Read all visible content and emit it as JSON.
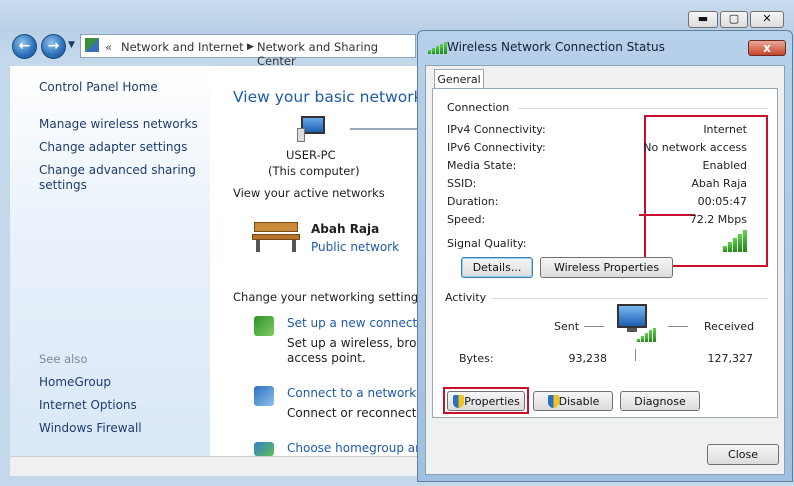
{
  "explorer": {
    "breadcrumb": [
      "Network and Internet",
      "Network and Sharing Center"
    ],
    "left_links": [
      "Control Panel Home",
      "Manage wireless networks",
      "Change adapter settings",
      "Change advanced sharing settings"
    ],
    "see_also_heading": "See also",
    "see_also": [
      "HomeGroup",
      "Internet Options",
      "Windows Firewall"
    ],
    "main_title": "View your basic network in",
    "computer_name": "USER-PC",
    "computer_sub": "(This computer)",
    "active_networks_heading": "View your active networks",
    "network_name": "Abah Raja",
    "network_type": "Public network",
    "change_settings_heading": "Change your networking settings",
    "tasks": [
      {
        "title": "Set up a new connection",
        "desc1": "Set up a wireless, broadb",
        "desc2": "access point."
      },
      {
        "title": "Connect to a network",
        "desc1": "Connect or reconnect to",
        "desc2": ""
      },
      {
        "title": "Choose homegroup and",
        "desc1": "",
        "desc2": ""
      }
    ]
  },
  "dialog": {
    "title": "Wireless Network Connection Status",
    "close_glyph": "x",
    "tab": "General",
    "connection_heading": "Connection",
    "rows": [
      {
        "label": "IPv4 Connectivity:",
        "value": "Internet"
      },
      {
        "label": "IPv6 Connectivity:",
        "value": "No network access"
      },
      {
        "label": "Media State:",
        "value": "Enabled"
      },
      {
        "label": "SSID:",
        "value": "Abah Raja"
      },
      {
        "label": "Duration:",
        "value": "00:05:47"
      },
      {
        "label": "Speed:",
        "value": "72.2 Mbps"
      }
    ],
    "signal_label": "Signal Quality:",
    "signal_bars": 5,
    "details_button": "Details...",
    "wireless_properties_button": "Wireless Properties",
    "activity_heading": "Activity",
    "sent_label": "Sent",
    "received_label": "Received",
    "bytes_label": "Bytes:",
    "bytes_sent": "93,238",
    "bytes_received": "127,327",
    "properties_button": "Properties",
    "disable_button": "Disable",
    "diagnose_button": "Diagnose",
    "close_button": "Close"
  },
  "colors": {
    "highlight": "#c8102e",
    "link": "#1e5aa8"
  }
}
